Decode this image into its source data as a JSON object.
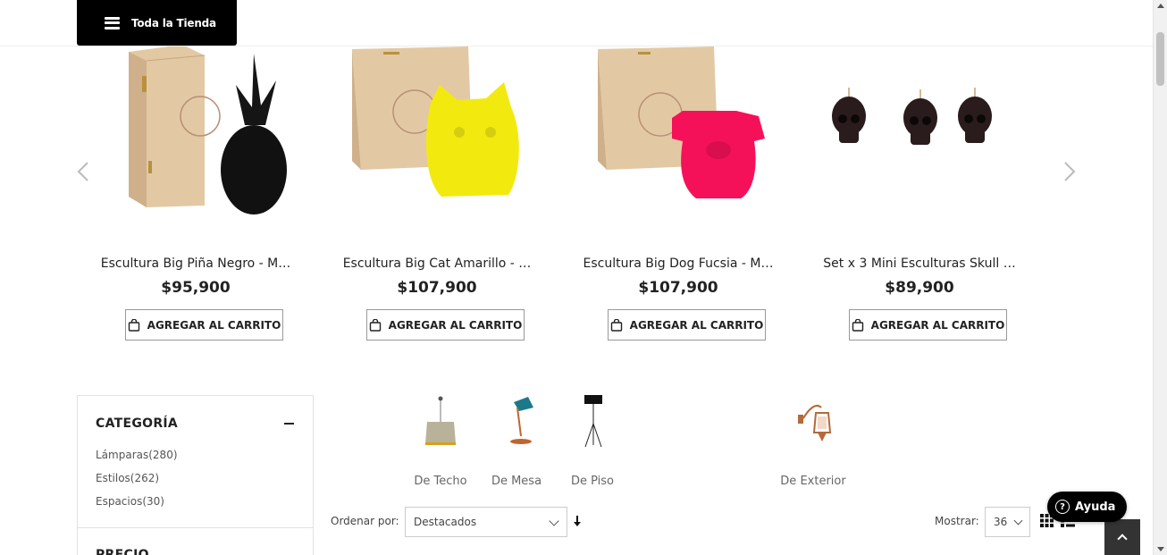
{
  "header": {
    "store_menu_label": "Toda la Tienda"
  },
  "carousel": {
    "products": [
      {
        "name": "Escultura Big Piña Negro - M…",
        "price": "$95,900",
        "cart_label": "AGREGAR AL CARRITO",
        "image": "pineapple-candle"
      },
      {
        "name": "Escultura Big Cat Amarillo - …",
        "price": "$107,900",
        "cart_label": "AGREGAR AL CARRITO",
        "image": "cat-candle"
      },
      {
        "name": "Escultura Big Dog Fucsia - M…",
        "price": "$107,900",
        "cart_label": "AGREGAR AL CARRITO",
        "image": "dog-candle"
      },
      {
        "name": "Set x 3 Mini Esculturas Skull …",
        "price": "$89,900",
        "cart_label": "AGREGAR AL CARRITO",
        "image": "skull-candles"
      }
    ]
  },
  "sidebar": {
    "category_title": "CATEGORÍA",
    "items": [
      {
        "label": "Lámparas(280)"
      },
      {
        "label": "Estilos(262)"
      },
      {
        "label": "Espacios(30)"
      }
    ],
    "price_title": "PRECIO"
  },
  "subcategories": [
    {
      "label": "De Techo",
      "icon": "pendant-lamp-icon"
    },
    {
      "label": "De Mesa",
      "icon": "desk-lamp-icon"
    },
    {
      "label": "De Piso",
      "icon": "floor-lamp-icon"
    },
    {
      "label": "De Exterior",
      "icon": "wall-lantern-icon"
    }
  ],
  "toolbar": {
    "sort_label": "Ordenar por:",
    "sort_value": "Destacados",
    "show_label": "Mostrar:",
    "show_value": "36"
  },
  "help": {
    "label": "Ayuda"
  },
  "colors": {
    "cat_yellow": "#f2ea0f",
    "dog_pink": "#f5115a",
    "black_button": "#000000",
    "wood": "#e2c9a4"
  }
}
